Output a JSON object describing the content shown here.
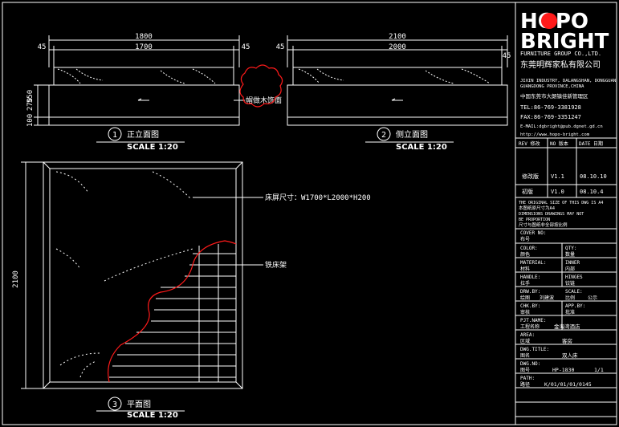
{
  "logo": {
    "wordmark_top": "HOPO",
    "wordmark_bottom": "BRIGHT"
  },
  "company": {
    "name_en": "FURNITURE GROUP CO.,LTD.",
    "name_cn": "东莞明辉家私有限公司",
    "address_en_1": "JIXIN INDUSTRY, DALANGSHAN, DONGGUAN",
    "address_en_2": "GUANGDONG PROVINCE,CHINA",
    "address_cn": "中国东莞市大朗镇佳新管理区",
    "tel": "TEL:86-769-3381928",
    "fax": "FAX:86-769-3351247",
    "email": "E-MAIL:dgbright@pub.dgnet.gd.cn",
    "web": "http://www.hopo-bright.com"
  },
  "revision": {
    "header": [
      "REV 修改",
      "NO 版本",
      "DATE 日期"
    ],
    "rows": [
      [
        "修改版",
        "V1.1",
        "08.10.10"
      ],
      [
        "初版",
        "V1.0",
        "08.10.4"
      ]
    ]
  },
  "notes": [
    "THE ORIGINAL SIZE OF THIS DWG IS A4",
    "本图纸原尺寸为A4",
    "DIMENSIONS DRAWINGS MAY NOT",
    "BE PROPORTION",
    "尺寸与图纸非全部按比例"
  ],
  "fields": [
    {
      "label": "COVER NO:",
      "label_cn": "布号",
      "value": ""
    },
    {
      "label": "COLOR:",
      "label_cn": "颜色",
      "value": "QTY:",
      "value2": "数量"
    },
    {
      "label": "MATERIAL:",
      "label_cn": "材料",
      "value": "INNER",
      "value2": "内部"
    },
    {
      "label": "HANDLE:",
      "label_cn": "拉手",
      "value": "HINGES",
      "value2": "铰链"
    },
    {
      "label": "DRW.BY:",
      "label_cn": "绘图",
      "value": "刘建波",
      "scale_label": "SCALE:",
      "scale_cn": "比例",
      "scale_val": "公示"
    },
    {
      "label": "CHK.BY:",
      "label_cn": "审核",
      "value": "APP.BY:",
      "value2": "批准"
    },
    {
      "label": "PJT.NAME:",
      "label_cn": "工程名称",
      "value": "金海湾酒店",
      "value2": ""
    },
    {
      "label": "AREA:",
      "label_cn": "区域",
      "value": "客房",
      "value2": ""
    },
    {
      "label": "DWG.TITLE:",
      "label_cn": "图名",
      "value": "双人床",
      "value2": ""
    },
    {
      "label": "DWG.NO:",
      "label_cn": "图号",
      "value": "HP-1830",
      "value2": "1/1"
    },
    {
      "label": "PATH:",
      "label_cn": "路径",
      "value": "K/01/01/01/0145",
      "value2": ""
    }
  ],
  "views": {
    "front": {
      "number": "1",
      "title": "正立面图",
      "scale": "SCALE 1:20",
      "dims": {
        "total": "1800",
        "inner": "1700",
        "left": "45",
        "right": "45",
        "h_total": "550",
        "h_mid": "270",
        "h_base": "100"
      },
      "callout": "帽做木饰面"
    },
    "side": {
      "number": "2",
      "title": "侧立面图",
      "scale": "SCALE 1:20",
      "dims": {
        "total": "2100",
        "inner": "2000",
        "left": "45",
        "right": "45"
      }
    },
    "plan": {
      "number": "3",
      "title": "平面图",
      "scale": "SCALE 1:20",
      "dim_height": "2100",
      "label_size": "床屏尺寸：W1700*L2000*H200",
      "label_frame": "铁床架"
    }
  },
  "colors": {
    "line": "#ffffff",
    "accent": "#ff1a1a",
    "background": "#000000"
  }
}
